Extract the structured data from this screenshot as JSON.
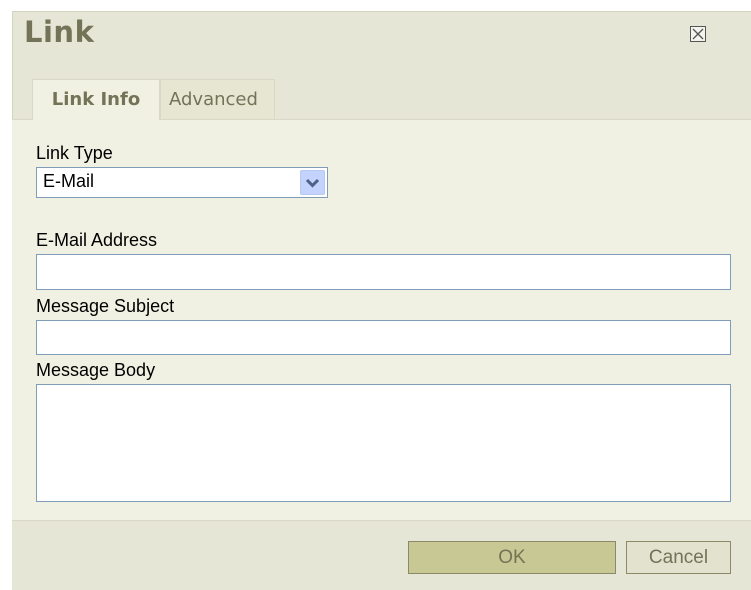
{
  "dialog": {
    "title": "Link",
    "close_icon": "close-icon"
  },
  "tabs": [
    {
      "label": "Link Info",
      "active": true
    },
    {
      "label": "Advanced",
      "active": false
    }
  ],
  "form": {
    "link_type_label": "Link Type",
    "link_type_value": "E-Mail",
    "email_label": "E-Mail Address",
    "email_value": "",
    "subject_label": "Message Subject",
    "subject_value": "",
    "body_label": "Message Body",
    "body_value": ""
  },
  "buttons": {
    "ok": "OK",
    "cancel": "Cancel"
  },
  "colors": {
    "dialog_bg": "#e6e6d6",
    "panel_bg": "#f1f1e3",
    "title": "#737357",
    "input_border": "#7f9db9",
    "ok_button": "#c8c894"
  }
}
